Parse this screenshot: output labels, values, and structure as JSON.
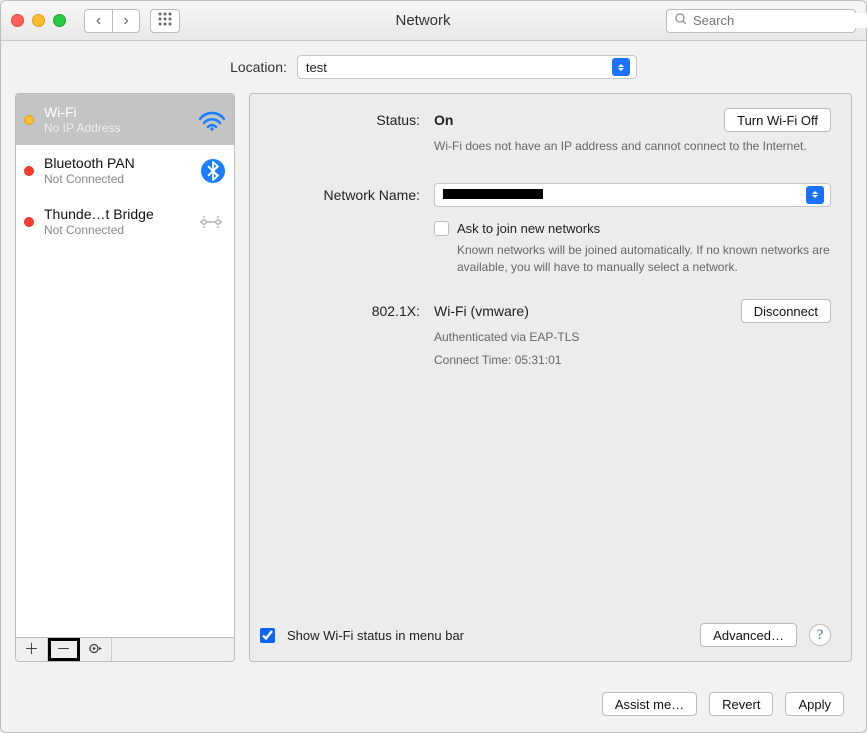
{
  "titlebar": {
    "title": "Network",
    "search_placeholder": "Search"
  },
  "location": {
    "label": "Location:",
    "value": "test"
  },
  "services": [
    {
      "name": "Wi-Fi",
      "sub": "No IP Address",
      "dot": "orange",
      "icon": "wifi",
      "selected": true
    },
    {
      "name": "Bluetooth PAN",
      "sub": "Not Connected",
      "dot": "red",
      "icon": "bluetooth",
      "selected": false
    },
    {
      "name": "Thunde…t Bridge",
      "sub": "Not Connected",
      "dot": "red",
      "icon": "tbolt",
      "selected": false
    }
  ],
  "status": {
    "label": "Status:",
    "value": "On",
    "toggle_button": "Turn Wi-Fi Off",
    "note": "Wi-Fi does not have an IP address and cannot connect to the Internet."
  },
  "network_name": {
    "label": "Network Name:",
    "value_redacted": true,
    "ask_checkbox_checked": false,
    "ask_label": "Ask to join new networks",
    "ask_note": "Known networks will be joined automatically. If no known networks are available, you will have to manually select a network."
  },
  "dot1x": {
    "label": "802.1X:",
    "profile": "Wi-Fi (vmware)",
    "button": "Disconnect",
    "auth_line": "Authenticated via EAP-TLS",
    "time_line": "Connect Time: 05:31:01"
  },
  "menu_bar": {
    "checked": true,
    "label": "Show Wi-Fi status in menu bar",
    "advanced_button": "Advanced…"
  },
  "footer": {
    "assist": "Assist me…",
    "revert": "Revert",
    "apply": "Apply"
  }
}
